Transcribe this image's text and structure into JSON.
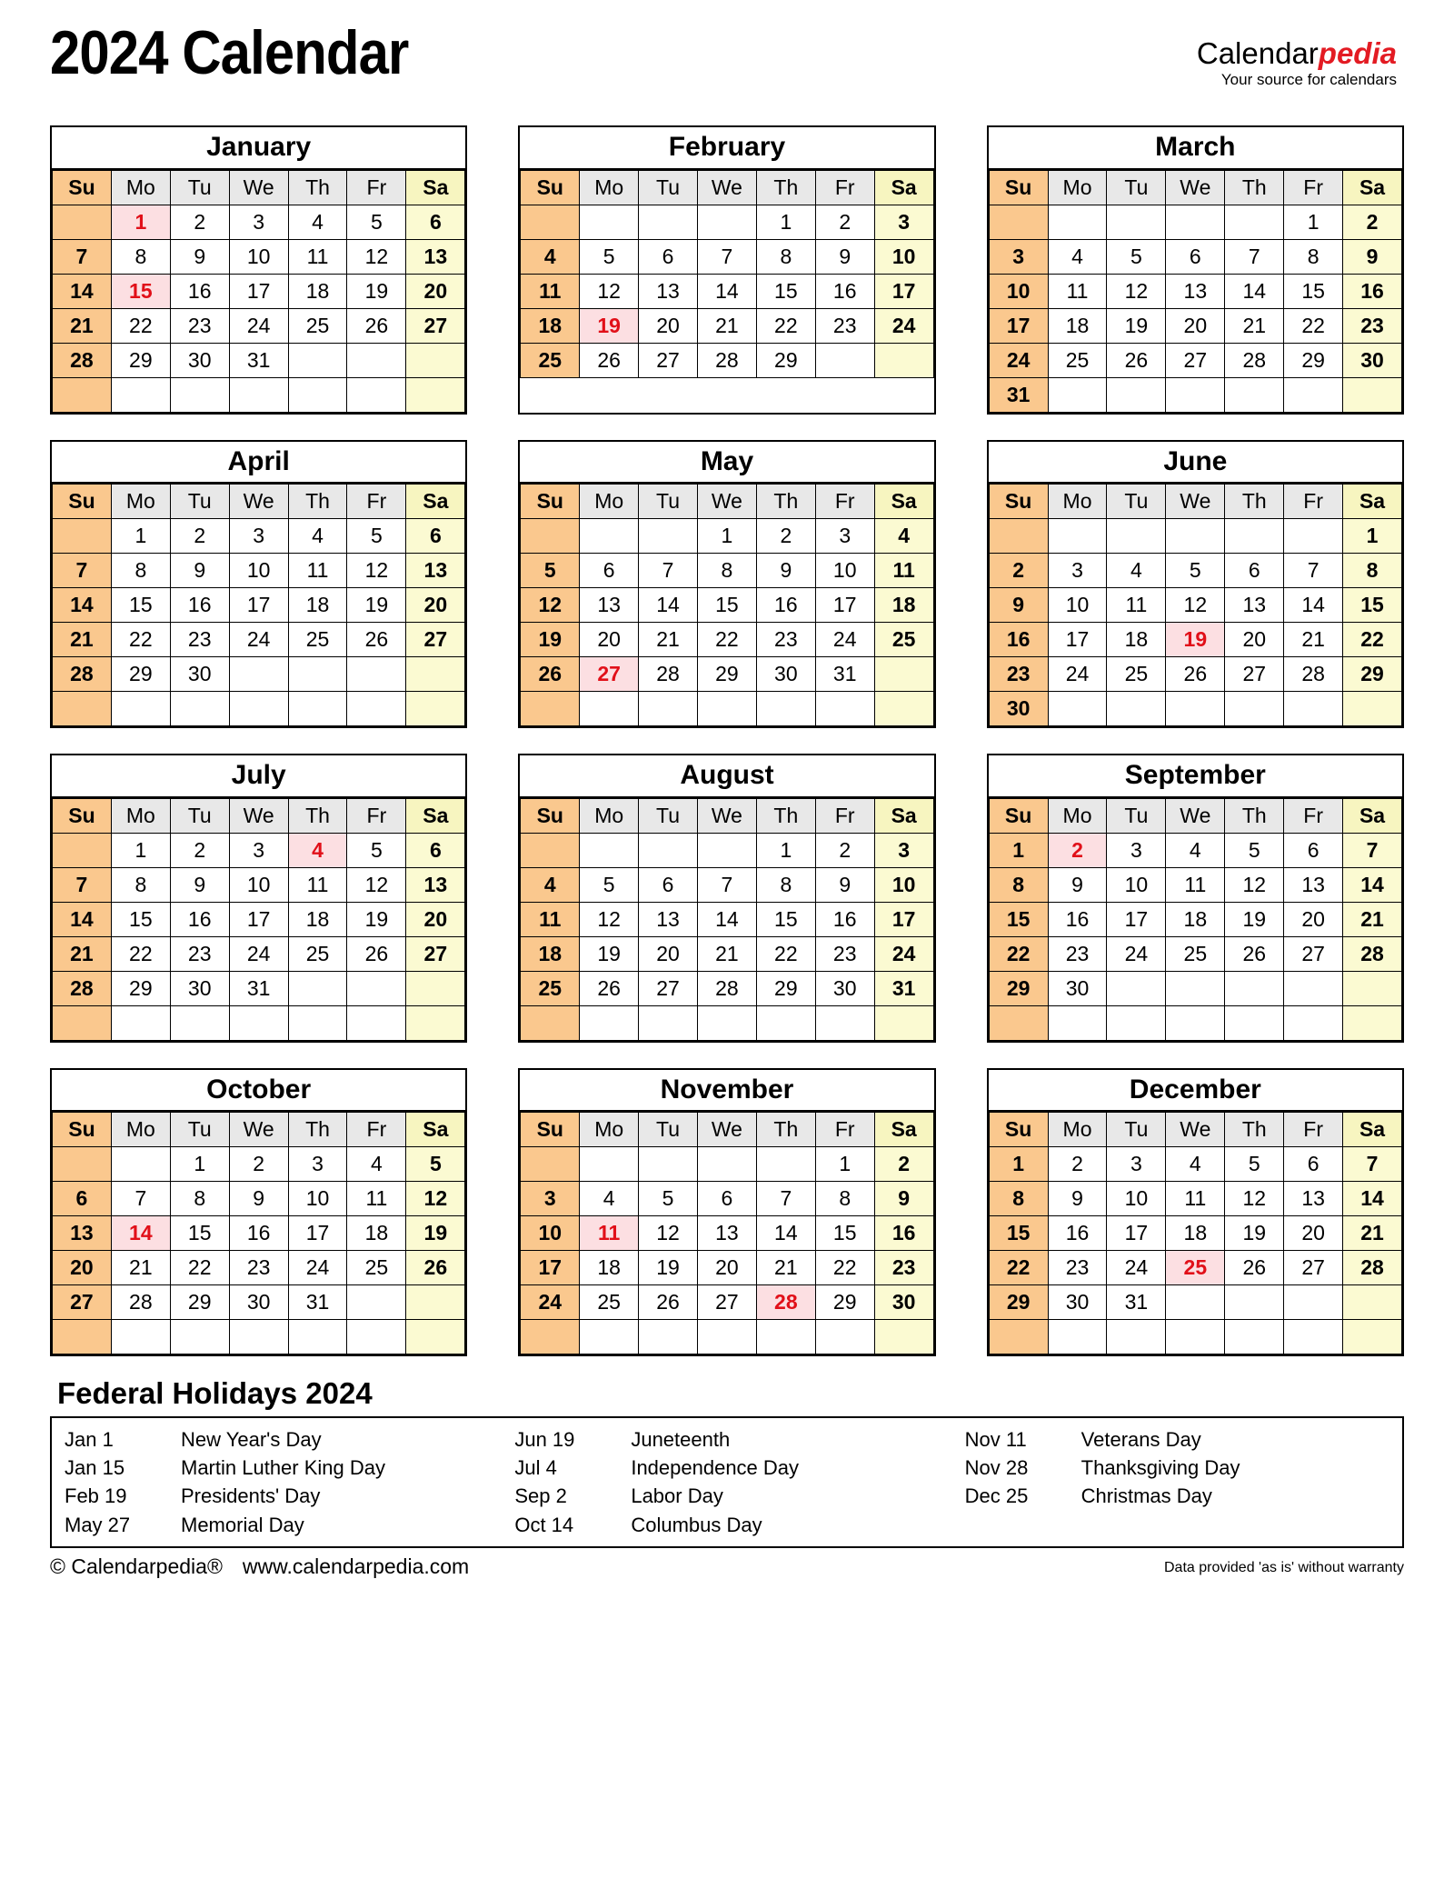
{
  "header": {
    "title": "2024 Calendar",
    "brand_main": "Calendar",
    "brand_accent": "pedia",
    "brand_tagline": "Your source for calendars",
    "accent_color": "#e31b23"
  },
  "colors": {
    "sunday_bg": "#fac88e",
    "saturday_bg": "#fbfad2",
    "weekday_header_bg": "#e8e8e8",
    "holiday_bg": "#fcdfe2",
    "holiday_text": "#e11019"
  },
  "weekday_headers": [
    "Su",
    "Mo",
    "Tu",
    "We",
    "Th",
    "Fr",
    "Sa"
  ],
  "months": [
    {
      "name": "January",
      "weeks": [
        [
          "",
          "1",
          "2",
          "3",
          "4",
          "5",
          "6"
        ],
        [
          "7",
          "8",
          "9",
          "10",
          "11",
          "12",
          "13"
        ],
        [
          "14",
          "15",
          "16",
          "17",
          "18",
          "19",
          "20"
        ],
        [
          "21",
          "22",
          "23",
          "24",
          "25",
          "26",
          "27"
        ],
        [
          "28",
          "29",
          "30",
          "31",
          "",
          "",
          ""
        ],
        [
          "",
          "",
          "",
          "",
          "",
          "",
          ""
        ]
      ],
      "holidays": [
        1,
        15
      ]
    },
    {
      "name": "February",
      "weeks": [
        [
          "",
          "",
          "",
          "",
          "1",
          "2",
          "3"
        ],
        [
          "4",
          "5",
          "6",
          "7",
          "8",
          "9",
          "10"
        ],
        [
          "11",
          "12",
          "13",
          "14",
          "15",
          "16",
          "17"
        ],
        [
          "18",
          "19",
          "20",
          "21",
          "22",
          "23",
          "24"
        ],
        [
          "25",
          "26",
          "27",
          "28",
          "29",
          "",
          ""
        ]
      ],
      "holidays": [
        19
      ]
    },
    {
      "name": "March",
      "weeks": [
        [
          "",
          "",
          "",
          "",
          "",
          "1",
          "2"
        ],
        [
          "3",
          "4",
          "5",
          "6",
          "7",
          "8",
          "9"
        ],
        [
          "10",
          "11",
          "12",
          "13",
          "14",
          "15",
          "16"
        ],
        [
          "17",
          "18",
          "19",
          "20",
          "21",
          "22",
          "23"
        ],
        [
          "24",
          "25",
          "26",
          "27",
          "28",
          "29",
          "30"
        ],
        [
          "31",
          "",
          "",
          "",
          "",
          "",
          ""
        ]
      ],
      "holidays": []
    },
    {
      "name": "April",
      "weeks": [
        [
          "",
          "1",
          "2",
          "3",
          "4",
          "5",
          "6"
        ],
        [
          "7",
          "8",
          "9",
          "10",
          "11",
          "12",
          "13"
        ],
        [
          "14",
          "15",
          "16",
          "17",
          "18",
          "19",
          "20"
        ],
        [
          "21",
          "22",
          "23",
          "24",
          "25",
          "26",
          "27"
        ],
        [
          "28",
          "29",
          "30",
          "",
          "",
          "",
          ""
        ],
        [
          "",
          "",
          "",
          "",
          "",
          "",
          ""
        ]
      ],
      "holidays": []
    },
    {
      "name": "May",
      "weeks": [
        [
          "",
          "",
          "",
          "1",
          "2",
          "3",
          "4"
        ],
        [
          "5",
          "6",
          "7",
          "8",
          "9",
          "10",
          "11"
        ],
        [
          "12",
          "13",
          "14",
          "15",
          "16",
          "17",
          "18"
        ],
        [
          "19",
          "20",
          "21",
          "22",
          "23",
          "24",
          "25"
        ],
        [
          "26",
          "27",
          "28",
          "29",
          "30",
          "31",
          ""
        ],
        [
          "",
          "",
          "",
          "",
          "",
          "",
          ""
        ]
      ],
      "holidays": [
        27
      ]
    },
    {
      "name": "June",
      "weeks": [
        [
          "",
          "",
          "",
          "",
          "",
          "",
          "1"
        ],
        [
          "2",
          "3",
          "4",
          "5",
          "6",
          "7",
          "8"
        ],
        [
          "9",
          "10",
          "11",
          "12",
          "13",
          "14",
          "15"
        ],
        [
          "16",
          "17",
          "18",
          "19",
          "20",
          "21",
          "22"
        ],
        [
          "23",
          "24",
          "25",
          "26",
          "27",
          "28",
          "29"
        ],
        [
          "30",
          "",
          "",
          "",
          "",
          "",
          ""
        ]
      ],
      "holidays": [
        19
      ]
    },
    {
      "name": "July",
      "weeks": [
        [
          "",
          "1",
          "2",
          "3",
          "4",
          "5",
          "6"
        ],
        [
          "7",
          "8",
          "9",
          "10",
          "11",
          "12",
          "13"
        ],
        [
          "14",
          "15",
          "16",
          "17",
          "18",
          "19",
          "20"
        ],
        [
          "21",
          "22",
          "23",
          "24",
          "25",
          "26",
          "27"
        ],
        [
          "28",
          "29",
          "30",
          "31",
          "",
          "",
          ""
        ],
        [
          "",
          "",
          "",
          "",
          "",
          "",
          ""
        ]
      ],
      "holidays": [
        4
      ]
    },
    {
      "name": "August",
      "weeks": [
        [
          "",
          "",
          "",
          "",
          "1",
          "2",
          "3"
        ],
        [
          "4",
          "5",
          "6",
          "7",
          "8",
          "9",
          "10"
        ],
        [
          "11",
          "12",
          "13",
          "14",
          "15",
          "16",
          "17"
        ],
        [
          "18",
          "19",
          "20",
          "21",
          "22",
          "23",
          "24"
        ],
        [
          "25",
          "26",
          "27",
          "28",
          "29",
          "30",
          "31"
        ],
        [
          "",
          "",
          "",
          "",
          "",
          "",
          ""
        ]
      ],
      "holidays": []
    },
    {
      "name": "September",
      "weeks": [
        [
          "1",
          "2",
          "3",
          "4",
          "5",
          "6",
          "7"
        ],
        [
          "8",
          "9",
          "10",
          "11",
          "12",
          "13",
          "14"
        ],
        [
          "15",
          "16",
          "17",
          "18",
          "19",
          "20",
          "21"
        ],
        [
          "22",
          "23",
          "24",
          "25",
          "26",
          "27",
          "28"
        ],
        [
          "29",
          "30",
          "",
          "",
          "",
          "",
          ""
        ],
        [
          "",
          "",
          "",
          "",
          "",
          "",
          ""
        ]
      ],
      "holidays": [
        2
      ]
    },
    {
      "name": "October",
      "weeks": [
        [
          "",
          "",
          "1",
          "2",
          "3",
          "4",
          "5"
        ],
        [
          "6",
          "7",
          "8",
          "9",
          "10",
          "11",
          "12"
        ],
        [
          "13",
          "14",
          "15",
          "16",
          "17",
          "18",
          "19"
        ],
        [
          "20",
          "21",
          "22",
          "23",
          "24",
          "25",
          "26"
        ],
        [
          "27",
          "28",
          "29",
          "30",
          "31",
          "",
          ""
        ],
        [
          "",
          "",
          "",
          "",
          "",
          "",
          ""
        ]
      ],
      "holidays": [
        14
      ]
    },
    {
      "name": "November",
      "weeks": [
        [
          "",
          "",
          "",
          "",
          "",
          "1",
          "2"
        ],
        [
          "3",
          "4",
          "5",
          "6",
          "7",
          "8",
          "9"
        ],
        [
          "10",
          "11",
          "12",
          "13",
          "14",
          "15",
          "16"
        ],
        [
          "17",
          "18",
          "19",
          "20",
          "21",
          "22",
          "23"
        ],
        [
          "24",
          "25",
          "26",
          "27",
          "28",
          "29",
          "30"
        ],
        [
          "",
          "",
          "",
          "",
          "",
          "",
          ""
        ]
      ],
      "holidays": [
        11,
        28
      ]
    },
    {
      "name": "December",
      "weeks": [
        [
          "1",
          "2",
          "3",
          "4",
          "5",
          "6",
          "7"
        ],
        [
          "8",
          "9",
          "10",
          "11",
          "12",
          "13",
          "14"
        ],
        [
          "15",
          "16",
          "17",
          "18",
          "19",
          "20",
          "21"
        ],
        [
          "22",
          "23",
          "24",
          "25",
          "26",
          "27",
          "28"
        ],
        [
          "29",
          "30",
          "31",
          "",
          "",
          "",
          ""
        ],
        [
          "",
          "",
          "",
          "",
          "",
          "",
          ""
        ]
      ],
      "holidays": [
        25
      ]
    }
  ],
  "holidays_section": {
    "heading": "Federal Holidays 2024",
    "columns": [
      [
        {
          "date": "Jan 1",
          "name": "New Year's Day"
        },
        {
          "date": "Jan 15",
          "name": "Martin Luther King Day"
        },
        {
          "date": "Feb 19",
          "name": "Presidents' Day"
        },
        {
          "date": "May 27",
          "name": "Memorial Day"
        }
      ],
      [
        {
          "date": "Jun 19",
          "name": "Juneteenth"
        },
        {
          "date": "Jul 4",
          "name": "Independence Day"
        },
        {
          "date": "Sep 2",
          "name": "Labor Day"
        },
        {
          "date": "Oct 14",
          "name": "Columbus Day"
        }
      ],
      [
        {
          "date": "Nov 11",
          "name": "Veterans Day"
        },
        {
          "date": "Nov 28",
          "name": "Thanksgiving Day"
        },
        {
          "date": "Dec 25",
          "name": "Christmas Day"
        }
      ]
    ]
  },
  "footer": {
    "copyright": "© Calendarpedia®",
    "website": "www.calendarpedia.com",
    "disclaimer": "Data provided 'as is' without warranty"
  }
}
